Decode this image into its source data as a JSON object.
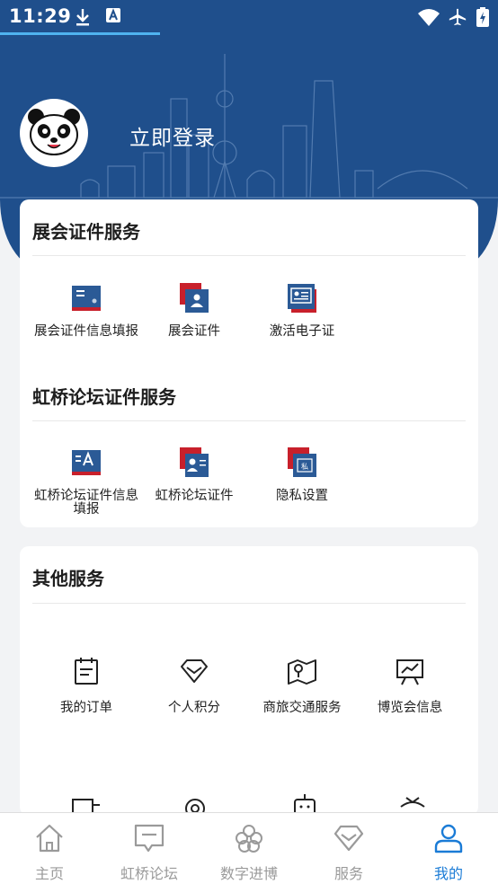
{
  "status": {
    "time": "11:29"
  },
  "header": {
    "login_label": "立即登录"
  },
  "expo_section": {
    "title": "展会证件服务",
    "items": [
      {
        "label": "展会证件信息填报",
        "icon": "expo-doc-form-icon"
      },
      {
        "label": "展会证件",
        "icon": "expo-badge-icon"
      },
      {
        "label": "激活电子证",
        "icon": "activate-ecard-icon"
      }
    ]
  },
  "forum_section": {
    "title": "虹桥论坛证件服务",
    "items": [
      {
        "label": "虹桥论坛证件信息填报",
        "icon": "forum-doc-form-icon"
      },
      {
        "label": "虹桥论坛证件",
        "icon": "forum-badge-icon"
      },
      {
        "label": "隐私设置",
        "icon": "privacy-settings-icon"
      }
    ]
  },
  "other_section": {
    "title": "其他服务",
    "items": [
      {
        "label": "我的订单",
        "icon": "order-icon"
      },
      {
        "label": "个人积分",
        "icon": "points-diamond-icon"
      },
      {
        "label": "商旅交通服务",
        "icon": "map-pin-icon"
      },
      {
        "label": "博览会信息",
        "icon": "presentation-board-icon"
      }
    ]
  },
  "tabbar": {
    "tabs": [
      {
        "label": "主页",
        "icon": "home-icon"
      },
      {
        "label": "虹桥论坛",
        "icon": "chat-bubble-icon"
      },
      {
        "label": "数字进博",
        "icon": "clover-icon"
      },
      {
        "label": "服务",
        "icon": "diamond-icon"
      },
      {
        "label": "我的",
        "icon": "person-icon"
      }
    ],
    "active_index": 4
  },
  "colors": {
    "header_blue": "#1f4f8c",
    "card_icon_blue": "#2b5a96",
    "card_icon_red": "#c8202b",
    "active_tab": "#1a7bd6"
  }
}
